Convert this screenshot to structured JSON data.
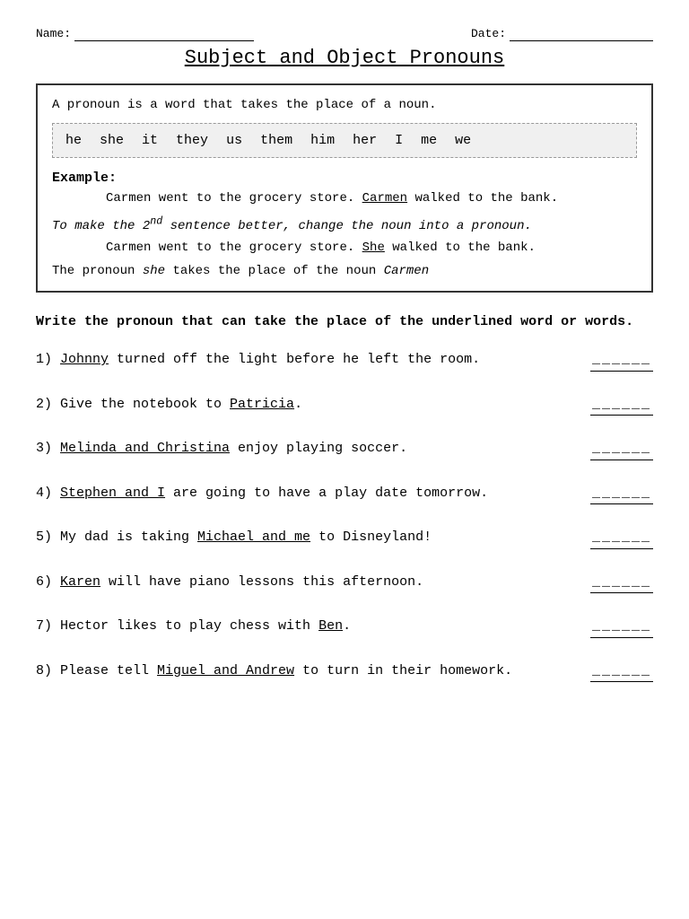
{
  "header": {
    "name_label": "Name:",
    "date_label": "Date:"
  },
  "title": "Subject and Object Pronouns",
  "info_box": {
    "intro": "A pronoun is a word that takes the place of a noun.",
    "pronouns": [
      "he",
      "she",
      "it",
      "they",
      "us",
      "them",
      "him",
      "her",
      "I",
      "me",
      "we"
    ],
    "example_label": "Example:",
    "example_sentence_1": "Carmen went to the grocery store. Carmen walked to the bank.",
    "example_sentence_1_underlined": "Carmen",
    "italic_instruction": "To make the 2",
    "italic_instruction_sup": "nd",
    "italic_instruction_rest": " sentence better, change the noun into a pronoun.",
    "example_sentence_2": "Carmen went to the grocery store. She walked to the bank.",
    "example_sentence_2_underlined": "She",
    "pronoun_note_1": "The pronoun ",
    "pronoun_note_italic1": "she",
    "pronoun_note_2": " takes the place of the noun ",
    "pronoun_note_italic2": "Carmen"
  },
  "directions": "Write the pronoun that can take the place of the underlined word or words.",
  "questions": [
    {
      "number": "1)",
      "text_before": " turned off the light before he left the room.",
      "underlined": "Johnny",
      "blank": "______"
    },
    {
      "number": "2)",
      "text_before": "Give the notebook to ",
      "underlined": "Patricia",
      "text_after": ".",
      "blank": "______"
    },
    {
      "number": "3)",
      "underlined": "Melinda and Christina",
      "text_after": " enjoy playing soccer.",
      "blank": "______"
    },
    {
      "number": "4)",
      "underlined": "Stephen and I",
      "text_after": " are going to have a play date tomorrow.",
      "blank": "______"
    },
    {
      "number": "5)",
      "text_before": "My dad is taking ",
      "underlined": "Michael and me",
      "text_after": " to Disneyland!",
      "blank": "______"
    },
    {
      "number": "6)",
      "underlined": "Karen",
      "text_after": " will have piano lessons this afternoon.",
      "blank": "______"
    },
    {
      "number": "7)",
      "text_before": "Hector likes to play chess with ",
      "underlined": "Ben",
      "text_after": ".",
      "blank": "______"
    },
    {
      "number": "8)",
      "text_before": "Please tell ",
      "underlined": "Miguel and Andrew",
      "text_after": " to turn in their homework.",
      "blank": "______"
    }
  ]
}
